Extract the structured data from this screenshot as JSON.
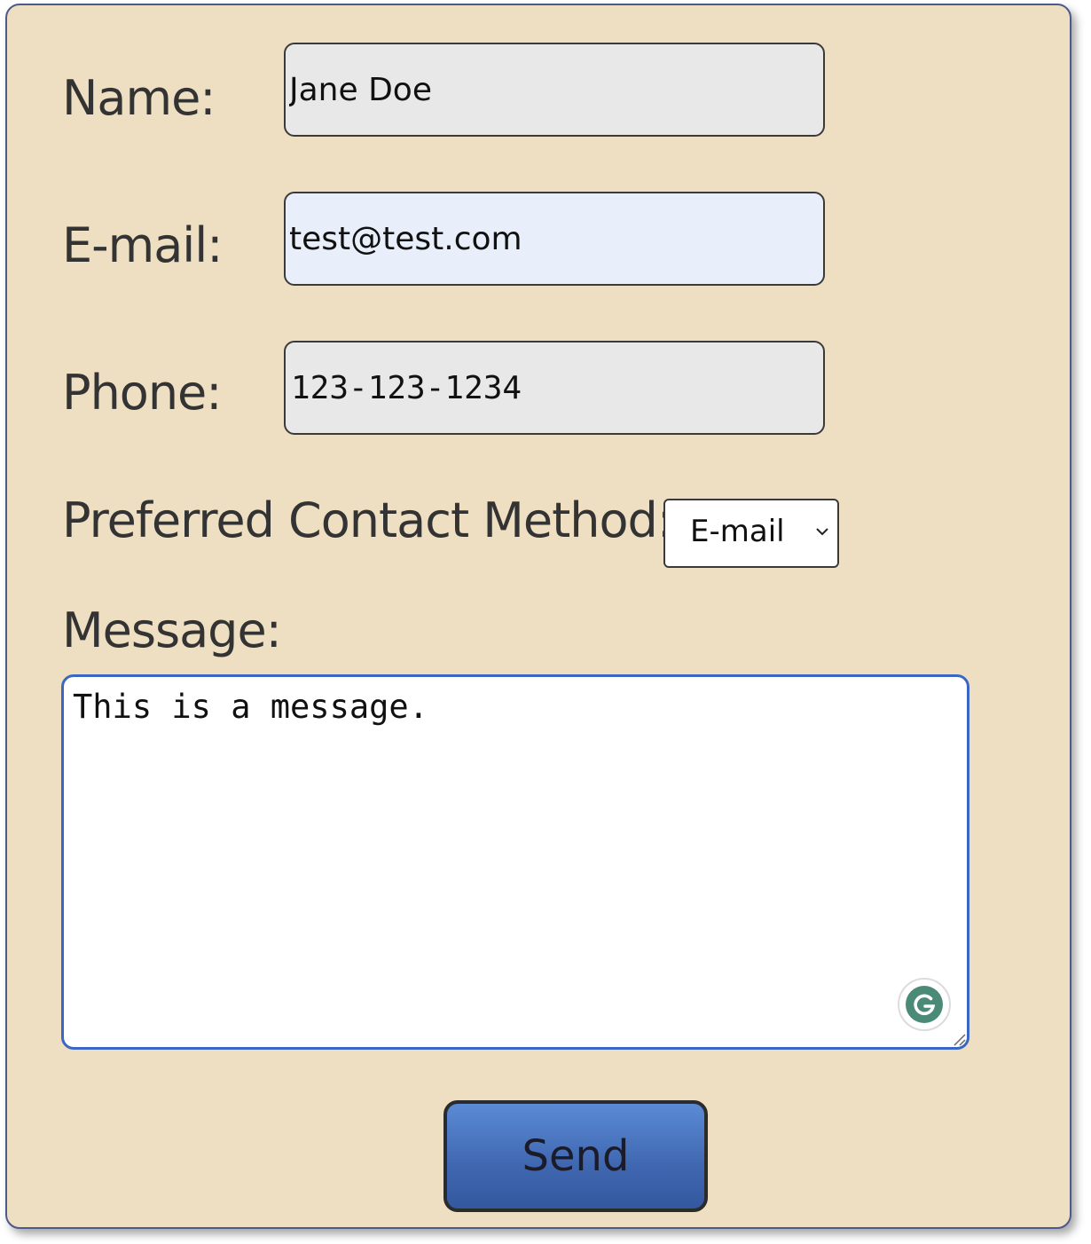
{
  "form": {
    "name_label": "Name:",
    "name_value": "Jane Doe",
    "email_label": "E-mail:",
    "email_value": "test@test.com",
    "phone_label": "Phone:",
    "phone_value": "123-123-1234",
    "contact_method_label": "Preferred Contact Method:",
    "contact_method_value": "E-mail",
    "message_label": "Message:",
    "message_value": "This is a message.",
    "send_label": "Send"
  },
  "colors": {
    "card_background": "#eedec2",
    "textarea_focus_border": "#3b66c4",
    "button_blue": "#4a76c4",
    "grammarly_green": "#4a8a76"
  },
  "icons": {
    "select_arrow": "chevron-down-icon",
    "grammarly": "grammarly-icon",
    "resize": "resize-handle-icon"
  }
}
